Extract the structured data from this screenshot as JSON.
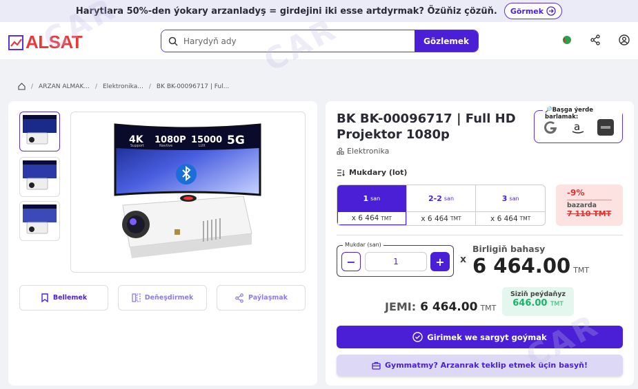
{
  "promo": {
    "text": "Harytlara 50%-den ýokary arzanladyş = girdejini iki esse artdyrmak? Özüňiz çözüň.",
    "button": "Görmek"
  },
  "header": {
    "logo": "ALSAT",
    "search_placeholder": "Harydyň ady",
    "search_button": "Gözlemek"
  },
  "breadcrumb": [
    "ARZAN ALMAK...",
    "Elektronika...",
    "BK BK-00096717 | Ful..."
  ],
  "gallery": {
    "badges": [
      "4K",
      "1080P",
      "15000",
      "5G"
    ],
    "badge_subs": [
      "Support",
      "Navtive",
      "LUX",
      ""
    ]
  },
  "actions": {
    "save": "Bellemek",
    "compare": "Deňeşdirmek",
    "share": "Paýlaşmak"
  },
  "product": {
    "title": "BK BK-00096717 | Full HD Projektor 1080p",
    "category": "Elektronika",
    "compare_label": "🔎Başga ýerde barlamak:"
  },
  "quantity": {
    "label": "Mukdary (lot)",
    "tiers": [
      {
        "qty": "1",
        "unit": "san",
        "price": "x 6 464",
        "cur": "TMT"
      },
      {
        "qty": "2-2",
        "unit": "san",
        "price": "x 6 464",
        "cur": "TMT"
      },
      {
        "qty": "3",
        "unit": "san",
        "price": "x 6 464",
        "cur": "TMT"
      }
    ],
    "discount": {
      "percent": "-9%",
      "label": "bazarda",
      "old_price": "7 110 TMT"
    },
    "input_label": "Mukdar (san)",
    "value": "1",
    "minus": "−",
    "plus": "+",
    "times": "x"
  },
  "pricing": {
    "unit_label": "Birligiň bahasy",
    "unit_price": "6 464.00",
    "currency": "TMT",
    "total_label": "JEMI:",
    "total": "6 464.00",
    "profit_label": "Siziň peýdaňyz",
    "profit": "646.00"
  },
  "buttons": {
    "buy": "Girimek we sargyt goýmak",
    "cheaper": "Gymmatmy? Arzanrak teklip etmek üçin basyň!"
  },
  "colors": {
    "brand": "#4a1fd6",
    "accent_red": "#e8393b",
    "green": "#1bb36a"
  }
}
